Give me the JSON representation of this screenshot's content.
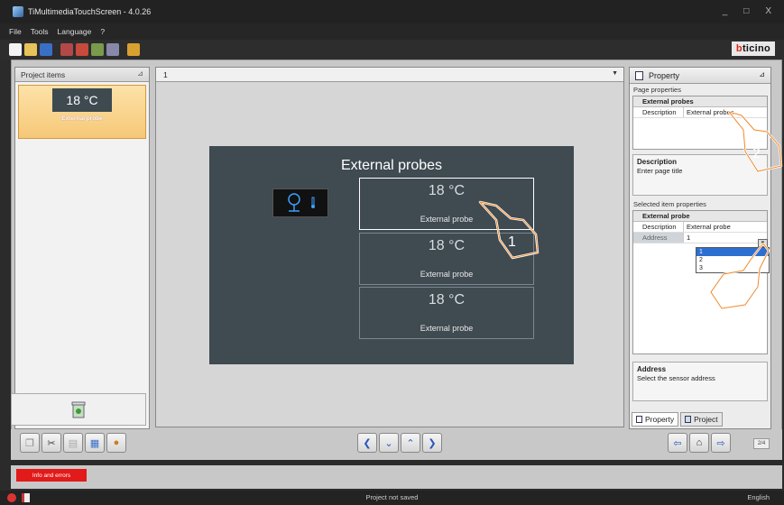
{
  "window": {
    "title": "TiMultimediaTouchScreen - 4.0.26",
    "controls": [
      "_",
      "□",
      "X"
    ]
  },
  "menu": {
    "items": [
      "File",
      "Tools",
      "Language",
      "?"
    ]
  },
  "brand": {
    "logo_text_prefix": "b",
    "logo_text_rest": "ticino"
  },
  "project_items": {
    "header": "Project items",
    "items": [
      {
        "value": "18 °C",
        "caption": "External probe"
      }
    ]
  },
  "canvas": {
    "page_selector": "1",
    "screen_title": "External probes",
    "tiles": [
      {
        "temp": "18 °C",
        "label": "External probe"
      },
      {
        "temp": "18 °C",
        "label": "External probe"
      },
      {
        "temp": "18 °C",
        "label": "External probe"
      }
    ]
  },
  "property_panel": {
    "header": "Property",
    "page_properties_label": "Page properties",
    "page_group": "External probes",
    "page_desc_key": "Description",
    "page_desc_value": "External probes",
    "help1_title": "Description",
    "help1_text": "Enter page title",
    "selected_label": "Selected item properties",
    "item_group": "External probe",
    "item_desc_key": "Description",
    "item_desc_value": "External probe",
    "address_key": "Address",
    "address_value": "1",
    "address_options": [
      "1",
      "2",
      "3"
    ],
    "help2_title": "Address",
    "help2_text": "Select the sensor address",
    "tab_property": "Property",
    "tab_project": "Project"
  },
  "callouts": [
    "1",
    "2",
    "3"
  ],
  "bottom": {
    "page_indicator": "2/4",
    "info_button": "Info and errors"
  },
  "status": {
    "message": "Project not saved",
    "language": "English"
  },
  "colors": {
    "screen_bg": "#3f4a51",
    "selected_item": "#f6c878",
    "accent_red": "#e21a1a",
    "nav_blue": "#2756b8"
  }
}
